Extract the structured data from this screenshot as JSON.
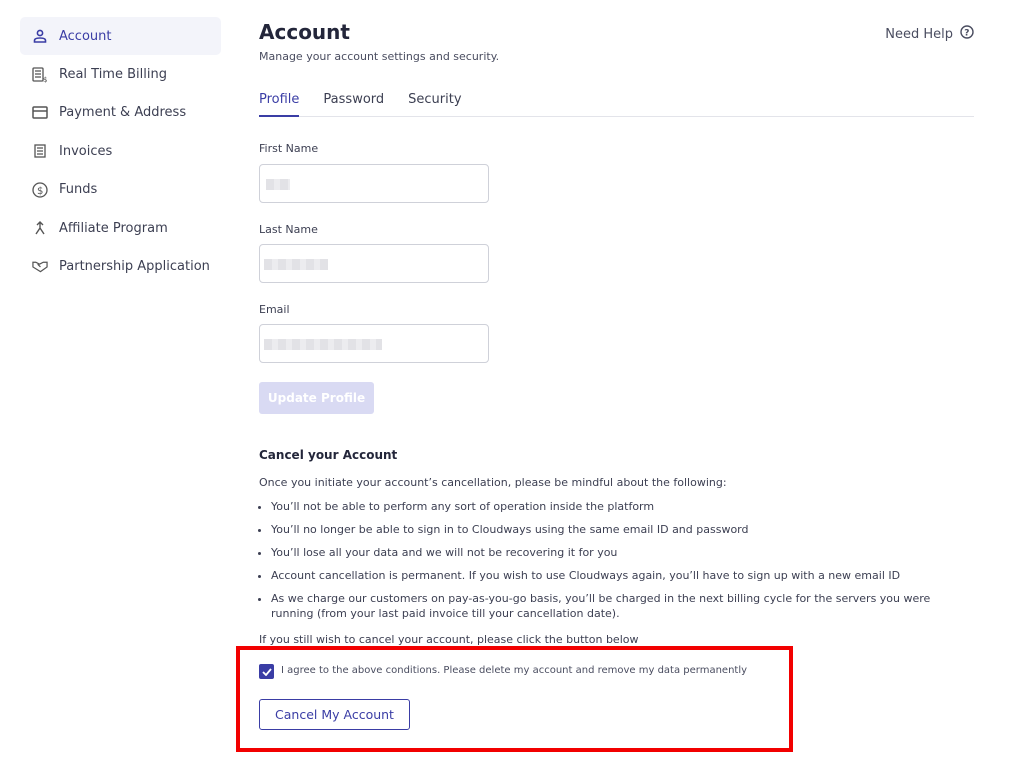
{
  "sidebar": {
    "items": [
      {
        "label": "Account",
        "icon": "user-icon",
        "active": true
      },
      {
        "label": "Real Time Billing",
        "icon": "billing-calculator-icon"
      },
      {
        "label": "Payment & Address",
        "icon": "credit-card-icon"
      },
      {
        "label": "Invoices",
        "icon": "invoice-icon"
      },
      {
        "label": "Funds",
        "icon": "dollar-circle-icon"
      },
      {
        "label": "Affiliate Program",
        "icon": "merge-arrow-icon"
      },
      {
        "label": "Partnership Application",
        "icon": "handshake-icon"
      }
    ]
  },
  "header": {
    "title": "Account",
    "subtitle": "Manage your account settings and security.",
    "help": "Need Help"
  },
  "tabs": [
    "Profile",
    "Password",
    "Security"
  ],
  "form": {
    "first_name_label": "First Name",
    "last_name_label": "Last Name",
    "email_label": "Email",
    "update_button": "Update Profile"
  },
  "cancel": {
    "title": "Cancel your Account",
    "intro": "Once you initiate your account’s cancellation, please be mindful about the following:",
    "bullets": [
      "You’ll not be able to perform any sort of operation inside the platform",
      "You’ll no longer be able to sign in to Cloudways using the same email ID and password",
      "You’ll lose all your data and we will not be recovering it for you",
      "Account cancellation is permanent. If you wish to use Cloudways again, you’ll have to sign up with a new email ID",
      "As we charge our customers on pay-as-you-go basis, you’ll be charged in the next billing cycle for the servers you were running (from your last paid invoice till your cancellation date)."
    ],
    "outro": "If you still wish to cancel your account, please click the button below",
    "agree": "I agree to the above conditions. Please delete my account and remove my data permanently",
    "agree_checked": true,
    "button": "Cancel My Account"
  },
  "colors": {
    "accent": "#3a3da5",
    "highlight": "#f20000"
  }
}
